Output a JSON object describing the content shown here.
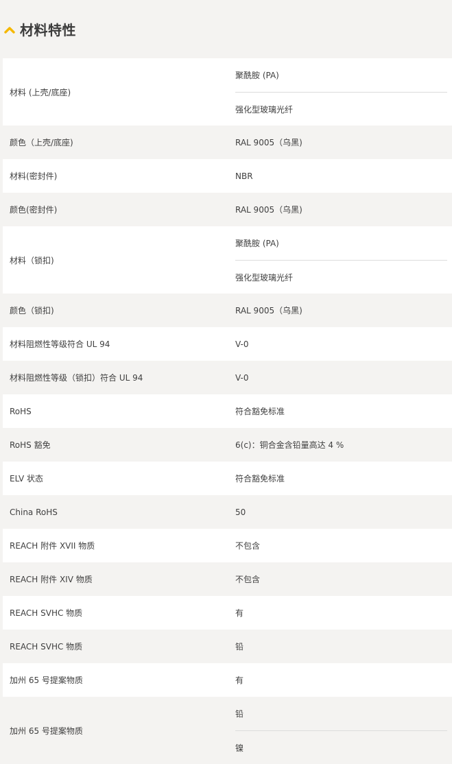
{
  "section": {
    "title": "材料特性",
    "icon": "chevron-up-icon",
    "accent_color": "#f5b800"
  },
  "rows": [
    {
      "key": "材料 (上壳/底座)",
      "values": [
        "聚酰胺 (PA)",
        "强化型玻璃光纤"
      ]
    },
    {
      "key": "颜色（上壳/底座)",
      "values": [
        "RAL 9005（乌黑)"
      ]
    },
    {
      "key": "材料(密封件)",
      "values": [
        "NBR"
      ]
    },
    {
      "key": "颜色(密封件)",
      "values": [
        "RAL 9005（乌黑)"
      ]
    },
    {
      "key": "材料（锁扣)",
      "values": [
        "聚酰胺 (PA)",
        "强化型玻璃光纤"
      ]
    },
    {
      "key": "颜色（锁扣)",
      "values": [
        "RAL 9005（乌黑)"
      ]
    },
    {
      "key": "材料阻燃性等级符合 UL 94",
      "values": [
        "V-0"
      ]
    },
    {
      "key": "材料阻燃性等级（锁扣）符合 UL 94",
      "values": [
        "V-0"
      ]
    },
    {
      "key": "RoHS",
      "values": [
        "符合豁免标准"
      ]
    },
    {
      "key": "RoHS 豁免",
      "values": [
        "6(c)：铜合金含铅量高达 4 %"
      ]
    },
    {
      "key": "ELV 状态",
      "values": [
        "符合豁免标准"
      ]
    },
    {
      "key": "China RoHS",
      "values": [
        "50"
      ]
    },
    {
      "key": "REACH 附件 XVII 物质",
      "values": [
        "不包含"
      ]
    },
    {
      "key": "REACH 附件 XIV 物质",
      "values": [
        "不包含"
      ]
    },
    {
      "key": "REACH SVHC 物质",
      "values": [
        "有"
      ]
    },
    {
      "key": "REACH SVHC 物质",
      "values": [
        "铅"
      ]
    },
    {
      "key": "加州 65 号提案物质",
      "values": [
        "有"
      ]
    },
    {
      "key": "加州 65 号提案物质",
      "values": [
        "铅",
        "镍"
      ]
    }
  ]
}
